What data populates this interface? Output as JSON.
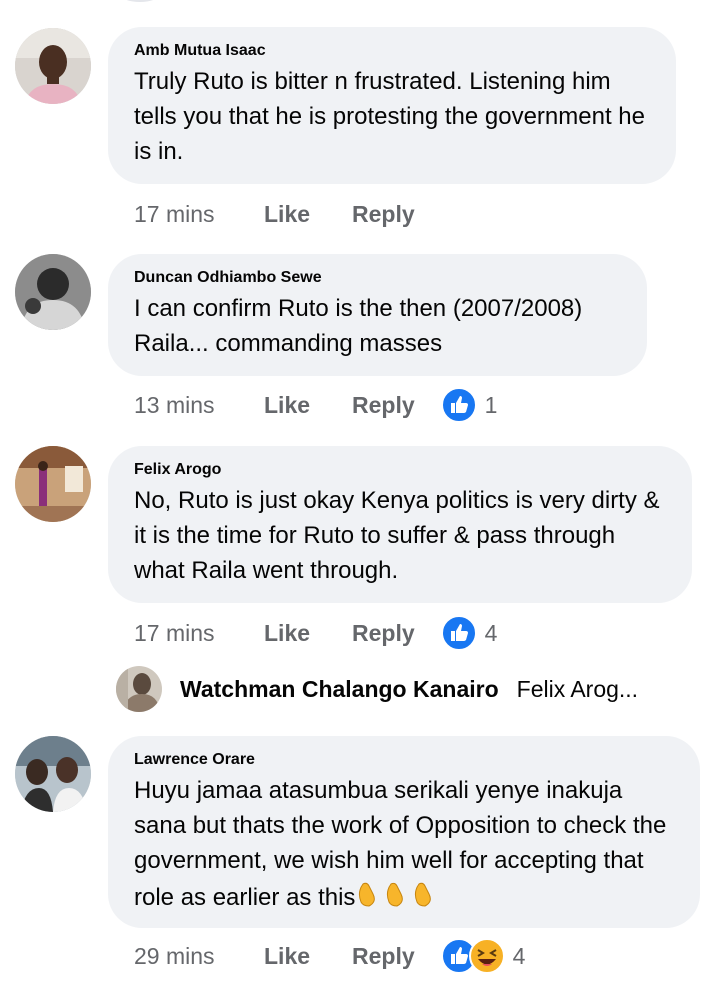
{
  "comments": [
    {
      "author": "Amb Mutua Isaac",
      "text": "Truly Ruto is bitter n frustrated. Listening him tells you that he is protesting the government he is in.",
      "time": "17 mins",
      "like_label": "Like",
      "reply_label": "Reply",
      "reaction_count": ""
    },
    {
      "author": "Duncan Odhiambo Sewe",
      "text": "I can confirm Ruto is the then (2007/2008) Raila... commanding masses",
      "time": "13 mins",
      "like_label": "Like",
      "reply_label": "Reply",
      "reaction_count": "1",
      "reactions": [
        "like"
      ]
    },
    {
      "author": "Felix Arogo",
      "text": "No, Ruto is just okay Kenya politics is very dirty & it is  the time for Ruto to suffer & pass through what Raila went through.",
      "time": "17 mins",
      "like_label": "Like",
      "reply_label": "Reply",
      "reaction_count": "4",
      "reactions": [
        "like"
      ]
    },
    {
      "author": "Lawrence Orare",
      "text": "Huyu jamaa atasumbua serikali yenye inakuja sana but thats the work of Opposition to check the government, we wish him well for accepting that role as earlier as this",
      "trailing_emoji": "clapping-hands x3",
      "time": "29 mins",
      "like_label": "Like",
      "reply_label": "Reply",
      "reaction_count": "4",
      "reactions": [
        "like",
        "haha"
      ]
    }
  ],
  "reply_preview": {
    "author": "Watchman Chalango Kanairo",
    "preview": "Felix Arog..."
  },
  "colors": {
    "bubble": "#f0f2f5",
    "meta_text": "#65676b",
    "text": "#050505",
    "like_blue": "#1877f2",
    "haha_yellow": "#f7b125"
  }
}
